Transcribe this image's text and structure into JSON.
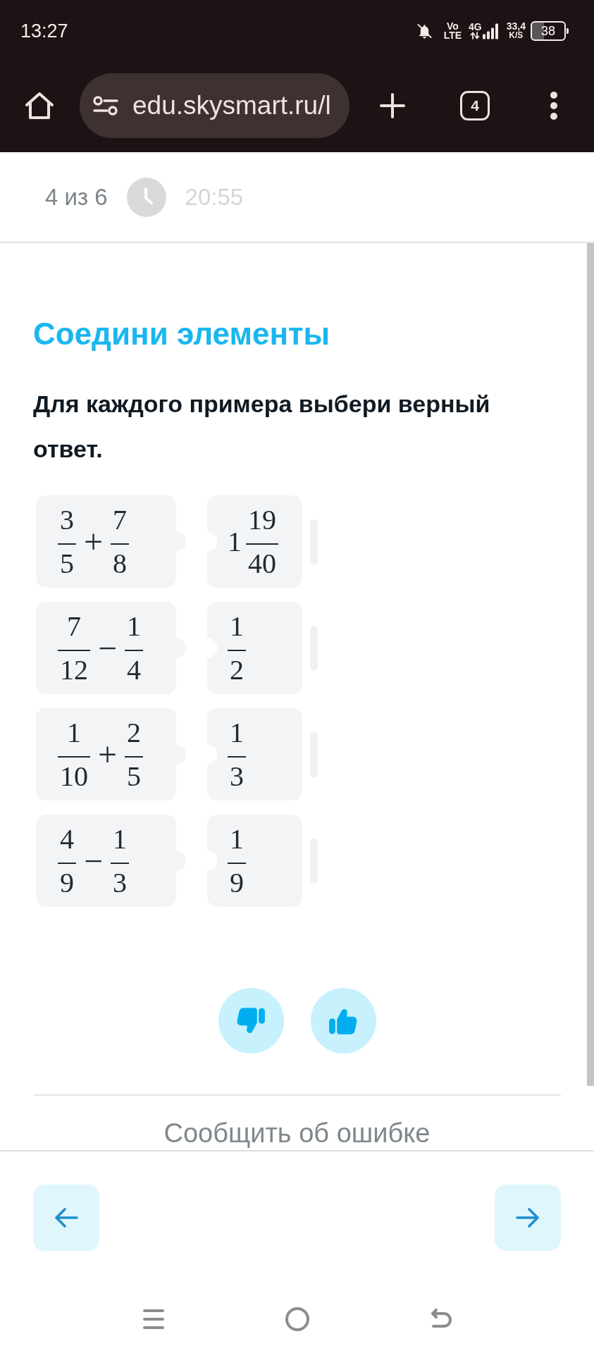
{
  "status_bar": {
    "time": "13:27",
    "volte_top": "Vo",
    "volte_bottom": "LTE",
    "network": "4G",
    "speed": "33,4",
    "speed_unit": "K/S",
    "battery": "38"
  },
  "browser_bar": {
    "url": "edu.skysmart.ru/l",
    "tab_count": "4"
  },
  "quiz_header": {
    "progress": "4 из 6",
    "timer": "20:55"
  },
  "task": {
    "title": "Соедини элементы",
    "instruction": "Для каждого примера выбери верный ответ.",
    "pairs": [
      {
        "example": [
          {
            "kind": "fraction",
            "numerator": "3",
            "denominator": "5"
          },
          {
            "kind": "operator",
            "text": "+"
          },
          {
            "kind": "fraction",
            "numerator": "7",
            "denominator": "8"
          }
        ],
        "answer": [
          {
            "kind": "integer",
            "text": "1"
          },
          {
            "kind": "fraction",
            "numerator": "19",
            "denominator": "40"
          }
        ]
      },
      {
        "example": [
          {
            "kind": "fraction",
            "numerator": "7",
            "denominator": "12"
          },
          {
            "kind": "operator",
            "text": "−"
          },
          {
            "kind": "fraction",
            "numerator": "1",
            "denominator": "4"
          }
        ],
        "answer": [
          {
            "kind": "fraction",
            "numerator": "1",
            "denominator": "2"
          }
        ]
      },
      {
        "example": [
          {
            "kind": "fraction",
            "numerator": "1",
            "denominator": "10"
          },
          {
            "kind": "operator",
            "text": "+"
          },
          {
            "kind": "fraction",
            "numerator": "2",
            "denominator": "5"
          }
        ],
        "answer": [
          {
            "kind": "fraction",
            "numerator": "1",
            "denominator": "3"
          }
        ]
      },
      {
        "example": [
          {
            "kind": "fraction",
            "numerator": "4",
            "denominator": "9"
          },
          {
            "kind": "operator",
            "text": "−"
          },
          {
            "kind": "fraction",
            "numerator": "1",
            "denominator": "3"
          }
        ],
        "answer": [
          {
            "kind": "fraction",
            "numerator": "1",
            "denominator": "9"
          }
        ]
      }
    ]
  },
  "report_link": "Сообщить об ошибке"
}
